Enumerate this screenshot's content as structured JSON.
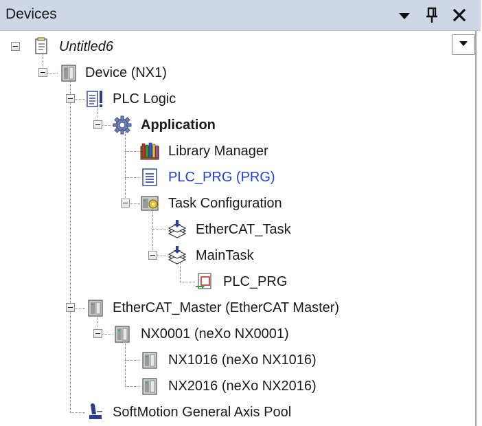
{
  "window": {
    "title": "Devices",
    "buttons": {
      "menu_icon": "dropdown-arrow-icon",
      "pin_icon": "pin-icon",
      "close_icon": "close-icon"
    }
  },
  "tree": {
    "nodes": [
      {
        "label": "Untitled6",
        "icon": "project-icon"
      },
      {
        "label": "Device (NX1)",
        "icon": "device-icon"
      },
      {
        "label": "PLC Logic",
        "icon": "plc-logic-icon"
      },
      {
        "label": "Application",
        "icon": "application-gear-icon"
      },
      {
        "label": "Library Manager",
        "icon": "library-manager-icon"
      },
      {
        "label": "PLC_PRG (PRG)",
        "icon": "program-icon"
      },
      {
        "label": "Task Configuration",
        "icon": "task-configuration-icon"
      },
      {
        "label": "EtherCAT_Task",
        "icon": "task-icon"
      },
      {
        "label": "MainTask",
        "icon": "task-icon"
      },
      {
        "label": "PLC_PRG",
        "icon": "program-call-icon"
      },
      {
        "label": "EtherCAT_Master (EtherCAT Master)",
        "icon": "device-icon"
      },
      {
        "label": "NX0001 (neXo NX0001)",
        "icon": "device-icon"
      },
      {
        "label": "NX1016 (neXo NX1016)",
        "icon": "device-icon"
      },
      {
        "label": "NX2016 (neXo NX2016)",
        "icon": "device-icon"
      },
      {
        "label": "SoftMotion General Axis Pool",
        "icon": "axis-pool-icon"
      }
    ]
  },
  "colors": {
    "titlebar": "#cfd6e5",
    "link": "#1f3fd8",
    "text": "#1a1a1a"
  }
}
